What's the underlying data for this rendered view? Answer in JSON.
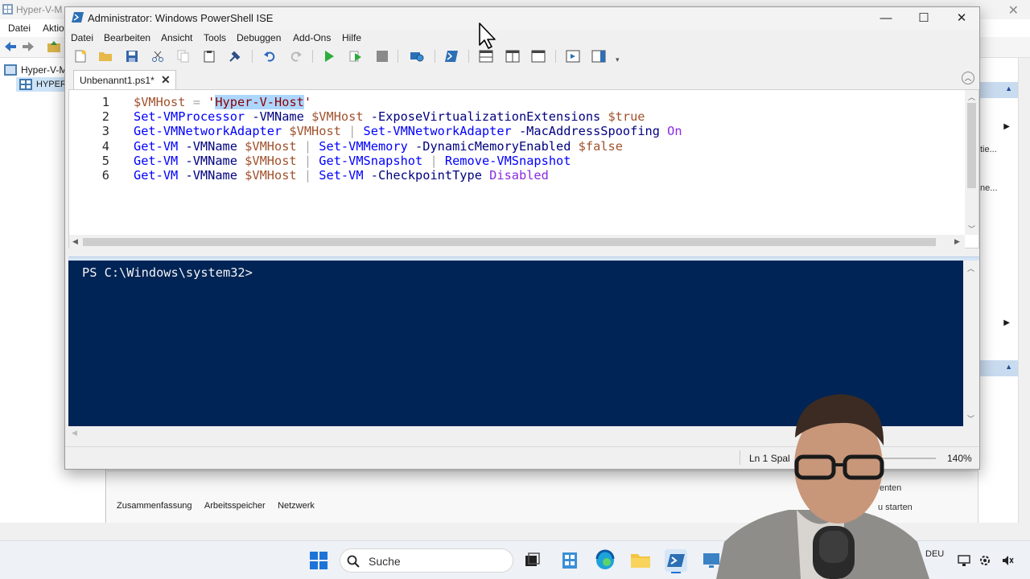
{
  "background_window": {
    "title": "Hyper-V-M",
    "menu": [
      "Datei",
      "Aktio"
    ],
    "tree": [
      "Hyper-V-M",
      "HYPER"
    ],
    "side_texts": [
      "tie...",
      "ne...",
      "en",
      "ten",
      "u starten"
    ],
    "bottom_tabs": [
      "Zusammenfassung",
      "Arbeitsspeicher",
      "Netzwerk"
    ]
  },
  "ise": {
    "title": "Administrator: Windows PowerShell ISE",
    "menu": [
      "Datei",
      "Bearbeiten",
      "Ansicht",
      "Tools",
      "Debuggen",
      "Add-Ons",
      "Hilfe"
    ],
    "tab_label": "Unbenannt1.ps1*",
    "tab_close": "✕",
    "controls": {
      "minimize": "—",
      "maximize": "☐",
      "close": "✕"
    },
    "editor": {
      "lines": [
        {
          "n": "1",
          "tokens": [
            {
              "t": "$VMHost",
              "k": "var"
            },
            {
              "t": " ",
              "k": "sp"
            },
            {
              "t": "=",
              "k": "op"
            },
            {
              "t": " ",
              "k": "sp"
            },
            {
              "t": "'",
              "k": "str"
            },
            {
              "t": "Hyper-V-Host",
              "k": "str-sel"
            },
            {
              "t": "'",
              "k": "str"
            }
          ]
        },
        {
          "n": "2",
          "tokens": [
            {
              "t": "Set-VMProcessor",
              "k": "cmd"
            },
            {
              "t": " ",
              "k": "sp"
            },
            {
              "t": "-VMName",
              "k": "param"
            },
            {
              "t": " ",
              "k": "sp"
            },
            {
              "t": "$VMHost",
              "k": "var"
            },
            {
              "t": " ",
              "k": "sp"
            },
            {
              "t": "-ExposeVirtualizationExtensions",
              "k": "param"
            },
            {
              "t": " ",
              "k": "sp"
            },
            {
              "t": "$true",
              "k": "var"
            }
          ]
        },
        {
          "n": "3",
          "tokens": [
            {
              "t": "Get-VMNetworkAdapter",
              "k": "cmd"
            },
            {
              "t": " ",
              "k": "sp"
            },
            {
              "t": "$VMHost",
              "k": "var"
            },
            {
              "t": " ",
              "k": "sp"
            },
            {
              "t": "|",
              "k": "pipe"
            },
            {
              "t": " ",
              "k": "sp"
            },
            {
              "t": "Set-VMNetworkAdapter",
              "k": "cmd"
            },
            {
              "t": " ",
              "k": "sp"
            },
            {
              "t": "-MacAddressSpoofing",
              "k": "param"
            },
            {
              "t": " ",
              "k": "sp"
            },
            {
              "t": "On",
              "k": "arg"
            }
          ]
        },
        {
          "n": "4",
          "tokens": [
            {
              "t": "Get-VM",
              "k": "cmd"
            },
            {
              "t": " ",
              "k": "sp"
            },
            {
              "t": "-VMName",
              "k": "param"
            },
            {
              "t": " ",
              "k": "sp"
            },
            {
              "t": "$VMHost",
              "k": "var"
            },
            {
              "t": " ",
              "k": "sp"
            },
            {
              "t": "|",
              "k": "pipe"
            },
            {
              "t": " ",
              "k": "sp"
            },
            {
              "t": "Set-VMMemory",
              "k": "cmd"
            },
            {
              "t": " ",
              "k": "sp"
            },
            {
              "t": "-DynamicMemoryEnabled",
              "k": "param"
            },
            {
              "t": " ",
              "k": "sp"
            },
            {
              "t": "$false",
              "k": "var"
            }
          ]
        },
        {
          "n": "5",
          "tokens": [
            {
              "t": "Get-VM",
              "k": "cmd"
            },
            {
              "t": " ",
              "k": "sp"
            },
            {
              "t": "-VMName",
              "k": "param"
            },
            {
              "t": " ",
              "k": "sp"
            },
            {
              "t": "$VMHost",
              "k": "var"
            },
            {
              "t": " ",
              "k": "sp"
            },
            {
              "t": "|",
              "k": "pipe"
            },
            {
              "t": " ",
              "k": "sp"
            },
            {
              "t": "Get-VMSnapshot",
              "k": "cmd"
            },
            {
              "t": " ",
              "k": "sp"
            },
            {
              "t": "|",
              "k": "pipe"
            },
            {
              "t": " ",
              "k": "sp"
            },
            {
              "t": "Remove-VMSnapshot",
              "k": "cmd"
            }
          ]
        },
        {
          "n": "6",
          "tokens": [
            {
              "t": "Get-VM",
              "k": "cmd"
            },
            {
              "t": " ",
              "k": "sp"
            },
            {
              "t": "-VMName",
              "k": "param"
            },
            {
              "t": " ",
              "k": "sp"
            },
            {
              "t": "$VMHost",
              "k": "var"
            },
            {
              "t": " ",
              "k": "sp"
            },
            {
              "t": "|",
              "k": "pipe"
            },
            {
              "t": " ",
              "k": "sp"
            },
            {
              "t": "Set-VM",
              "k": "cmd"
            },
            {
              "t": " ",
              "k": "sp"
            },
            {
              "t": "-CheckpointType",
              "k": "param"
            },
            {
              "t": " ",
              "k": "sp"
            },
            {
              "t": "Disabled",
              "k": "arg"
            }
          ]
        }
      ]
    },
    "console": {
      "prompt": "PS C:\\Windows\\system32>"
    },
    "status": {
      "position": "Ln 1  Spal",
      "zoom": "140%"
    }
  },
  "taskbar": {
    "search_label": "Suche",
    "language": "DEU"
  },
  "colors": {
    "console_bg": "#012456",
    "selection": "#add6ff",
    "cmdlet": "#0000ff",
    "parameter": "#000080",
    "variable": "#a0522d",
    "string": "#8b0000",
    "argument": "#8a2be2"
  }
}
